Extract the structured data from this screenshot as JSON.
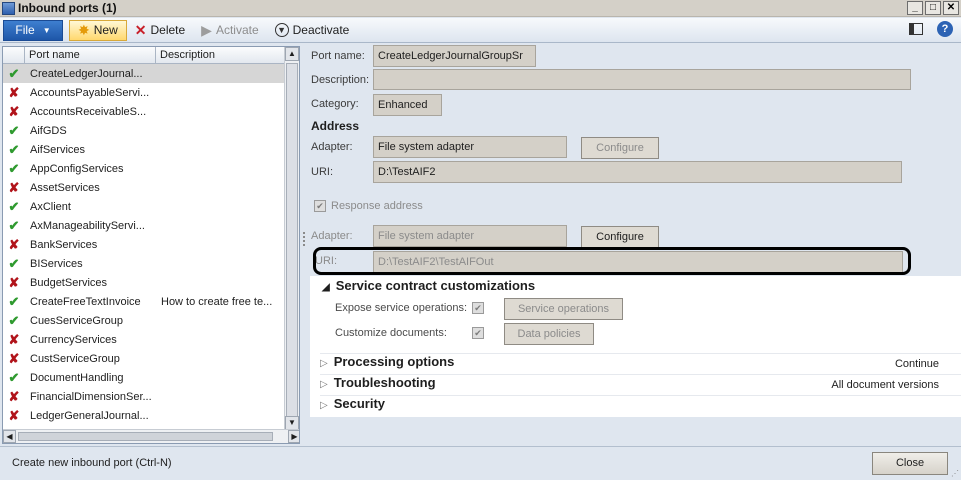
{
  "window": {
    "title": "Inbound ports (1)",
    "min": "_",
    "max": "□",
    "close": "✕"
  },
  "toolbar": {
    "file": "File",
    "new": "New",
    "delete": "Delete",
    "activate": "Activate",
    "deactivate": "Deactivate"
  },
  "list": {
    "headers": {
      "name": "Port name",
      "description": "Description"
    },
    "rows": [
      {
        "status": "ok",
        "name": "CreateLedgerJournal...",
        "desc": ""
      },
      {
        "status": "bad",
        "name": "AccountsPayableServi...",
        "desc": ""
      },
      {
        "status": "bad",
        "name": "AccountsReceivableS...",
        "desc": ""
      },
      {
        "status": "ok",
        "name": "AifGDS",
        "desc": ""
      },
      {
        "status": "ok",
        "name": "AifServices",
        "desc": ""
      },
      {
        "status": "ok",
        "name": "AppConfigServices",
        "desc": ""
      },
      {
        "status": "bad",
        "name": "AssetServices",
        "desc": ""
      },
      {
        "status": "ok",
        "name": "AxClient",
        "desc": ""
      },
      {
        "status": "ok",
        "name": "AxManageabilityServi...",
        "desc": ""
      },
      {
        "status": "bad",
        "name": "BankServices",
        "desc": ""
      },
      {
        "status": "ok",
        "name": "BIServices",
        "desc": ""
      },
      {
        "status": "bad",
        "name": "BudgetServices",
        "desc": ""
      },
      {
        "status": "ok",
        "name": "CreateFreeTextInvoice",
        "desc": "How to create free te..."
      },
      {
        "status": "ok",
        "name": "CuesServiceGroup",
        "desc": ""
      },
      {
        "status": "bad",
        "name": "CurrencyServices",
        "desc": ""
      },
      {
        "status": "bad",
        "name": "CustServiceGroup",
        "desc": ""
      },
      {
        "status": "ok",
        "name": "DocumentHandling",
        "desc": ""
      },
      {
        "status": "bad",
        "name": "FinancialDimensionSer...",
        "desc": ""
      },
      {
        "status": "bad",
        "name": "LedgerGeneralJournal...",
        "desc": ""
      }
    ]
  },
  "details": {
    "port_name_label": "Port name:",
    "port_name": "CreateLedgerJournalGroupSr",
    "description_label": "Description:",
    "description": "",
    "category_label": "Category:",
    "category": "Enhanced",
    "address_heading": "Address",
    "adapter_label": "Adapter:",
    "adapter": "File system adapter",
    "configure": "Configure",
    "uri_label": "URI:",
    "uri": "D:\\TestAIF2",
    "response_address": "Response address",
    "resp_adapter_label": "Adapter:",
    "resp_adapter": "File system adapter",
    "resp_configure": "Configure",
    "resp_uri_label": "URI:",
    "resp_uri": "D:\\TestAIF2\\TestAIFOut"
  },
  "contract": {
    "heading": "Service contract customizations",
    "expose_label": "Expose service operations:",
    "service_operations": "Service operations",
    "customize_label": "Customize documents:",
    "data_policies": "Data policies"
  },
  "sections": [
    {
      "label": "Processing options",
      "side": "Continue"
    },
    {
      "label": "Troubleshooting",
      "side": "All document versions"
    },
    {
      "label": "Security",
      "side": ""
    }
  ],
  "status": {
    "text": "Create new inbound port (Ctrl-N)",
    "close": "Close"
  }
}
